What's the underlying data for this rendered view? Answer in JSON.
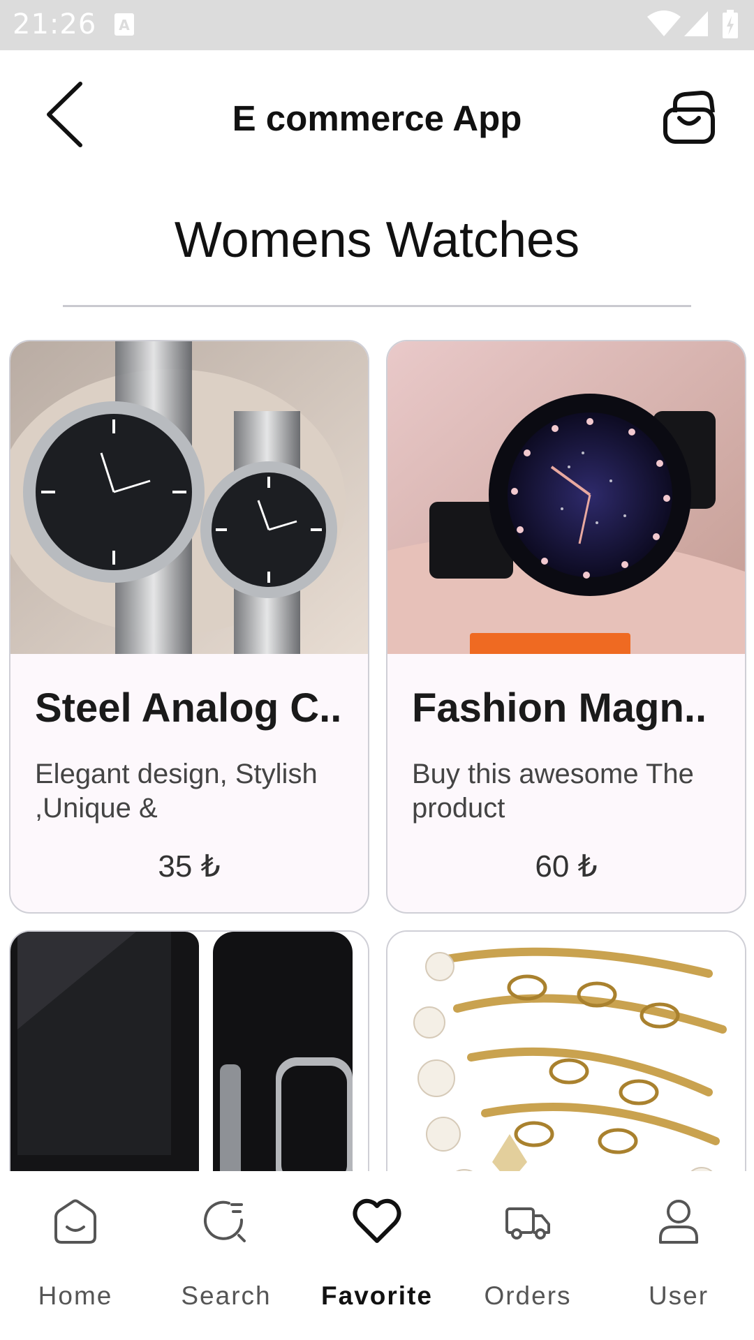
{
  "status_bar": {
    "time": "21:26"
  },
  "app_bar": {
    "title": "E commerce App"
  },
  "page": {
    "title": "Womens Watches"
  },
  "products": [
    {
      "name": "Steel Analog C..",
      "description": "Elegant design, Stylish ,Unique &",
      "price": "35 ₺"
    },
    {
      "name": "Fashion Magn..",
      "description": "Buy this awesome The product",
      "price": "60 ₺"
    },
    {
      "name": "",
      "description": "",
      "price": ""
    },
    {
      "name": "",
      "description": "",
      "price": ""
    }
  ],
  "bottom_nav": {
    "items": [
      {
        "label": "Home",
        "icon": "home-icon"
      },
      {
        "label": "Search",
        "icon": "search-icon"
      },
      {
        "label": "Favorite",
        "icon": "heart-icon"
      },
      {
        "label": "Orders",
        "icon": "truck-icon"
      },
      {
        "label": "User",
        "icon": "user-icon"
      }
    ],
    "active": "Favorite"
  },
  "colors": {
    "card_bg": "#fdf8fc",
    "card_border": "#cfcfd6",
    "status_bar": "#dcdcdc",
    "price_text": "#333333"
  }
}
